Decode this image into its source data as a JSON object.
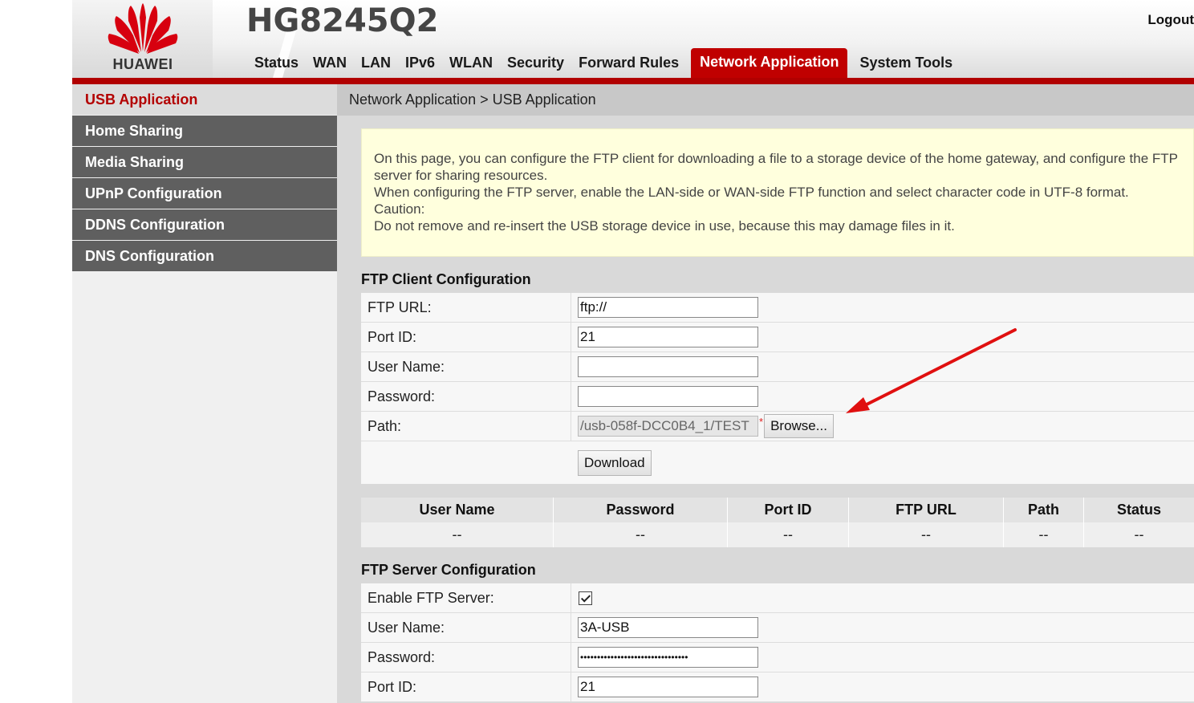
{
  "header": {
    "brand": "HUAWEI",
    "model": "HG8245Q2",
    "logout_label": "Logout",
    "brand_color": "#c00000"
  },
  "nav": {
    "items": [
      {
        "label": "Status"
      },
      {
        "label": "WAN"
      },
      {
        "label": "LAN"
      },
      {
        "label": "IPv6"
      },
      {
        "label": "WLAN"
      },
      {
        "label": "Security"
      },
      {
        "label": "Forward Rules"
      },
      {
        "label": "Network Application",
        "active": true
      },
      {
        "label": "System Tools"
      }
    ]
  },
  "sidebar": {
    "items": [
      {
        "label": "USB Application",
        "active": true
      },
      {
        "label": "Home Sharing"
      },
      {
        "label": "Media Sharing"
      },
      {
        "label": "UPnP Configuration"
      },
      {
        "label": "DDNS Configuration"
      },
      {
        "label": "DNS Configuration"
      }
    ]
  },
  "breadcrumb": "Network Application > USB Application",
  "notice": {
    "line1": "On this page, you can configure the FTP client for downloading a file to a storage device of the home gateway, and configure the FTP server for sharing resources.",
    "line2": "When configuring the FTP server, enable the LAN-side or WAN-side FTP function and select character code in UTF-8 format.",
    "line3": "Caution:",
    "line4": "Do not remove and re-insert the USB storage device in use, because this may damage files in it."
  },
  "ftp_client": {
    "title": "FTP Client Configuration",
    "url_label": "FTP URL:",
    "url_value": "ftp://",
    "port_label": "Port ID:",
    "port_value": "21",
    "user_label": "User Name:",
    "user_value": "",
    "password_label": "Password:",
    "password_value": "",
    "path_label": "Path:",
    "path_value": "/usb-058f-DCC0B4_1/TEST",
    "required_mark": "*",
    "browse_label": "Browse...",
    "download_label": "Download",
    "table": {
      "headers": [
        "User Name",
        "Password",
        "Port ID",
        "FTP URL",
        "Path",
        "Status"
      ],
      "row": [
        "--",
        "--",
        "--",
        "--",
        "--",
        "--"
      ]
    }
  },
  "ftp_server": {
    "title": "FTP Server Configuration",
    "enable_label": "Enable FTP Server:",
    "enabled": true,
    "user_label": "User Name:",
    "user_value": "3A-USB",
    "password_label": "Password:",
    "password_value": "••••••••••••••••••••••••••••••••",
    "port_label": "Port ID:",
    "port_value": "21"
  },
  "annotation": {
    "arrow_color": "#e01010"
  }
}
